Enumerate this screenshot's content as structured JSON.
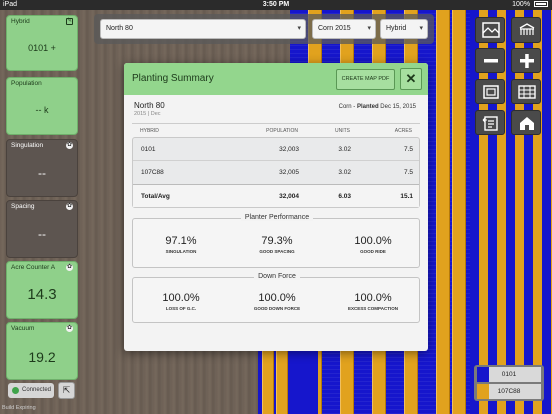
{
  "status_bar": {
    "carrier": "iPad",
    "time": "3:50 PM",
    "battery": "100%"
  },
  "left_cards": [
    {
      "label": "Hybrid",
      "value": "0101 +",
      "style": "green",
      "icon": "edit-icon"
    },
    {
      "label": "Population",
      "value": "-- k",
      "style": "green",
      "icon": ""
    },
    {
      "label": "Singulation",
      "value": "--",
      "style": "dark",
      "icon": "gear-icon"
    },
    {
      "label": "Spacing",
      "value": "--",
      "style": "dark",
      "icon": "gear-icon"
    },
    {
      "label": "Acre Counter A",
      "value": "14.3",
      "style": "green",
      "icon": "gear-icon"
    },
    {
      "label": "Vacuum",
      "value": "19.2",
      "style": "green",
      "icon": "gear-icon"
    }
  ],
  "connection": {
    "label": "Connected",
    "status_color": "#3fa34a"
  },
  "build_info": "Build Expiring",
  "top_selectors": {
    "field": "North 80",
    "season": "Corn 2015",
    "layer": "Hybrid"
  },
  "legend": [
    {
      "label": "0101",
      "color": "#1616cc"
    },
    {
      "label": "107C88",
      "color": "#e1a21e"
    }
  ],
  "modal": {
    "title": "Planting Summary",
    "pdf_button": "CREATE MAP PDF",
    "close_glyph": "✕",
    "field_name": "North 80",
    "field_sub": "2015 | Dec",
    "crop": "Corn -",
    "planted_label": "Planted",
    "planted_date": "Dec 15, 2015",
    "table": {
      "headers": {
        "hybrid": "HYBRID",
        "population": "POPULATION",
        "units": "UNITS",
        "acres": "ACRES"
      },
      "rows": [
        {
          "hybrid": "0101",
          "population": "32,003",
          "units": "3.02",
          "acres": "7.5"
        },
        {
          "hybrid": "107C88",
          "population": "32,005",
          "units": "3.02",
          "acres": "7.5"
        }
      ],
      "total": {
        "hybrid": "Total/Avg",
        "population": "32,004",
        "units": "6.03",
        "acres": "15.1"
      }
    },
    "planter_performance": {
      "title": "Planter Performance",
      "metrics": [
        {
          "value": "97.1%",
          "label": "SINGULATION"
        },
        {
          "value": "79.3%",
          "label": "GOOD SPACING"
        },
        {
          "value": "100.0%",
          "label": "GOOD RIDE"
        }
      ]
    },
    "down_force": {
      "title": "Down Force",
      "metrics": [
        {
          "value": "100.0%",
          "label": "LOSS OF G.C."
        },
        {
          "value": "100.0%",
          "label": "GOOD DOWN FORCE"
        },
        {
          "value": "100.0%",
          "label": "EXCESS COMPACTION"
        }
      ]
    }
  },
  "colors": {
    "accent_green": "#93d68d",
    "map_blue": "#1616cc",
    "map_orange": "#e1a21e"
  }
}
